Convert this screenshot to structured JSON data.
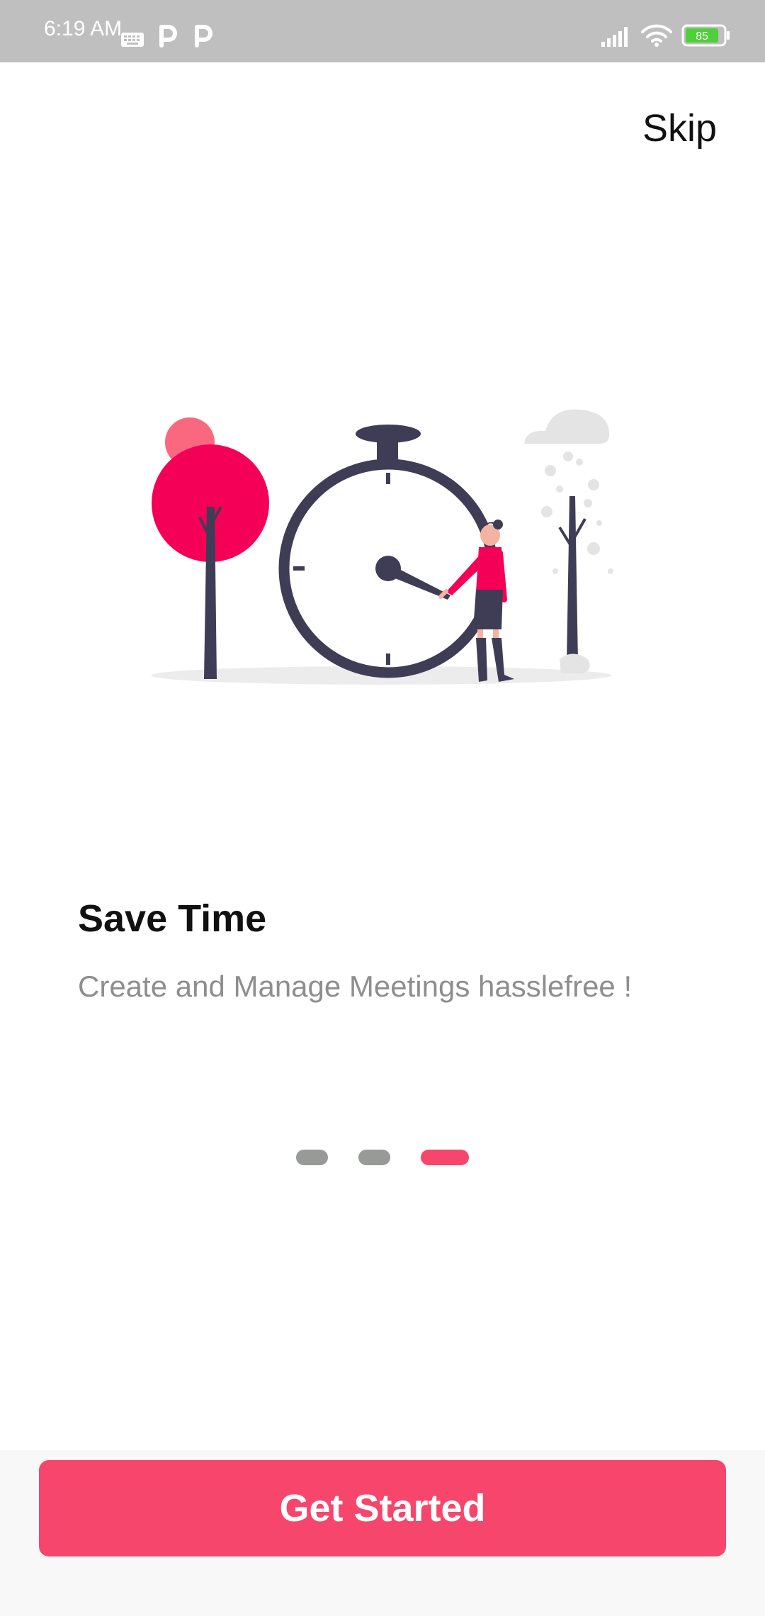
{
  "status_bar": {
    "time": "6:19 AM",
    "battery": "85",
    "icons": [
      "keyboard-icon",
      "parking-icon",
      "parking-icon",
      "signal-icon",
      "wifi-icon",
      "battery-icon"
    ]
  },
  "header": {
    "skip_label": "Skip"
  },
  "slide": {
    "title": "Save Time",
    "subtitle": "Create and Manage Meetings hasslefree !"
  },
  "pager": {
    "total": 3,
    "active_index": 2
  },
  "footer": {
    "cta_label": "Get Started"
  },
  "colors": {
    "accent": "#f7466b",
    "tree_red": "#f50057",
    "tree_pink": "#f9687f",
    "dark": "#3f3d56",
    "dot_inactive": "#979a97",
    "status_bar": "#bfbfbf",
    "battery_green": "#4fcf3a"
  }
}
